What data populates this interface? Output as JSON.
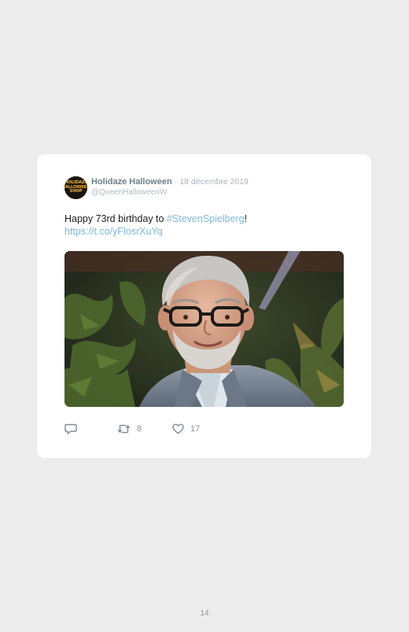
{
  "tweet": {
    "author_name": "Holidaze Halloween",
    "separator": "·",
    "date": "18 décembre 2019",
    "handle": "@QueenHalloweenW",
    "avatar_text": "HOLIDAZE HALLOWEEN SHOP",
    "text_prefix": "Happy 73rd birthday to ",
    "hashtag": "#StevenSpielberg",
    "text_suffix": "!",
    "link": "https://t.co/yFlosrXuYq",
    "image_alt": "Portrait photo of Steven Spielberg",
    "actions": {
      "reply_icon": "reply-icon",
      "retweet_icon": "retweet-icon",
      "retweet_count": "8",
      "like_icon": "heart-icon",
      "like_count": "17"
    }
  },
  "page": {
    "number": "14"
  }
}
